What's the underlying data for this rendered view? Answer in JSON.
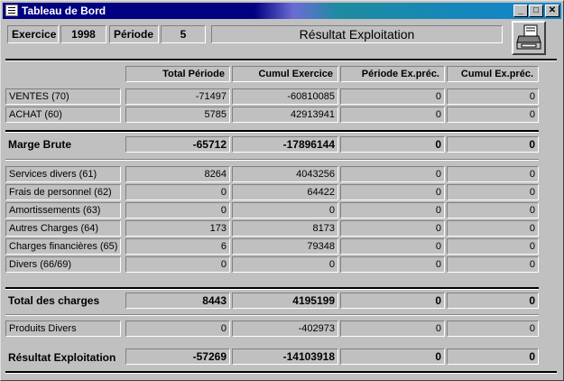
{
  "window": {
    "title": "Tableau de Bord"
  },
  "header": {
    "exercice_label": "Exercice",
    "exercice_value": "1998",
    "periode_label": "Période",
    "periode_value": "5",
    "report_title": "Résultat Exploitation"
  },
  "columns": [
    "Total Période",
    "Cumul Exercice",
    "Période Ex.préc.",
    "Cumul Ex.préc."
  ],
  "rows": {
    "ventes": {
      "label": "VENTES (70)",
      "values": [
        "-71497",
        "-60810085",
        "0",
        "0"
      ]
    },
    "achat": {
      "label": "ACHAT (60)",
      "values": [
        "5785",
        "42913941",
        "0",
        "0"
      ]
    },
    "marge": {
      "label": "Marge Brute",
      "values": [
        "-65712",
        "-17896144",
        "0",
        "0"
      ]
    },
    "services": {
      "label": "Services divers (61)",
      "values": [
        "8264",
        "4043256",
        "0",
        "0"
      ]
    },
    "personnel": {
      "label": "Frais de personnel (62)",
      "values": [
        "0",
        "64422",
        "0",
        "0"
      ]
    },
    "amort": {
      "label": "Amortissements (63)",
      "values": [
        "0",
        "0",
        "0",
        "0"
      ]
    },
    "autres": {
      "label": "Autres Charges (64)",
      "values": [
        "173",
        "8173",
        "0",
        "0"
      ]
    },
    "financieres": {
      "label": "Charges financières (65)",
      "values": [
        "6",
        "79348",
        "0",
        "0"
      ]
    },
    "divers": {
      "label": "Divers (66/69)",
      "values": [
        "0",
        "0",
        "0",
        "0"
      ]
    },
    "total_charges": {
      "label": "Total des charges",
      "values": [
        "8443",
        "4195199",
        "0",
        "0"
      ]
    },
    "produits": {
      "label": "Produits Divers",
      "values": [
        "0",
        "-402973",
        "0",
        "0"
      ]
    },
    "resultat": {
      "label": "Résultat Exploitation",
      "values": [
        "-57269",
        "-14103918",
        "0",
        "0"
      ]
    }
  },
  "icons": {
    "print": "printer-icon",
    "window": "form-icon"
  }
}
